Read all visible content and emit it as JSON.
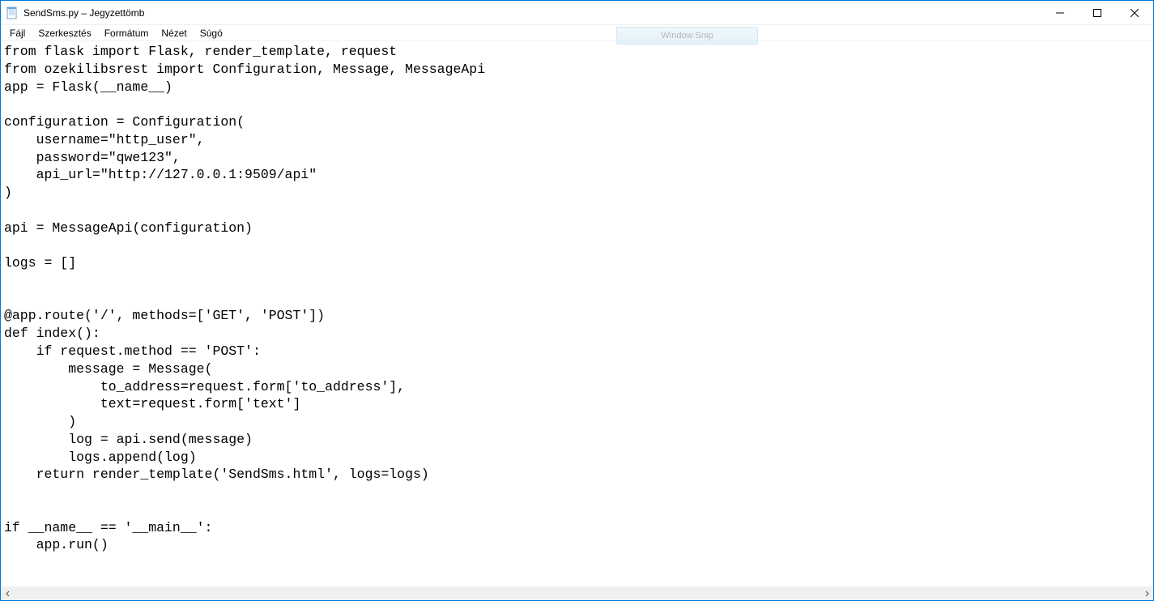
{
  "window": {
    "title": "SendSms.py – Jegyzettömb"
  },
  "menu": {
    "items": [
      "Fájl",
      "Szerkesztés",
      "Formátum",
      "Nézet",
      "Súgó"
    ]
  },
  "overlay": {
    "label": "Window Snip"
  },
  "editor": {
    "content": "from flask import Flask, render_template, request\nfrom ozekilibsrest import Configuration, Message, MessageApi\napp = Flask(__name__)\n\nconfiguration = Configuration(\n    username=\"http_user\",\n    password=\"qwe123\",\n    api_url=\"http://127.0.0.1:9509/api\"\n)\n\napi = MessageApi(configuration)\n\nlogs = []\n\n\n@app.route('/', methods=['GET', 'POST'])\ndef index():\n    if request.method == 'POST':\n        message = Message(\n            to_address=request.form['to_address'],\n            text=request.form['text']\n        )\n        log = api.send(message)\n        logs.append(log)\n    return render_template('SendSms.html', logs=logs)\n\n\nif __name__ == '__main__':\n    app.run()"
  }
}
